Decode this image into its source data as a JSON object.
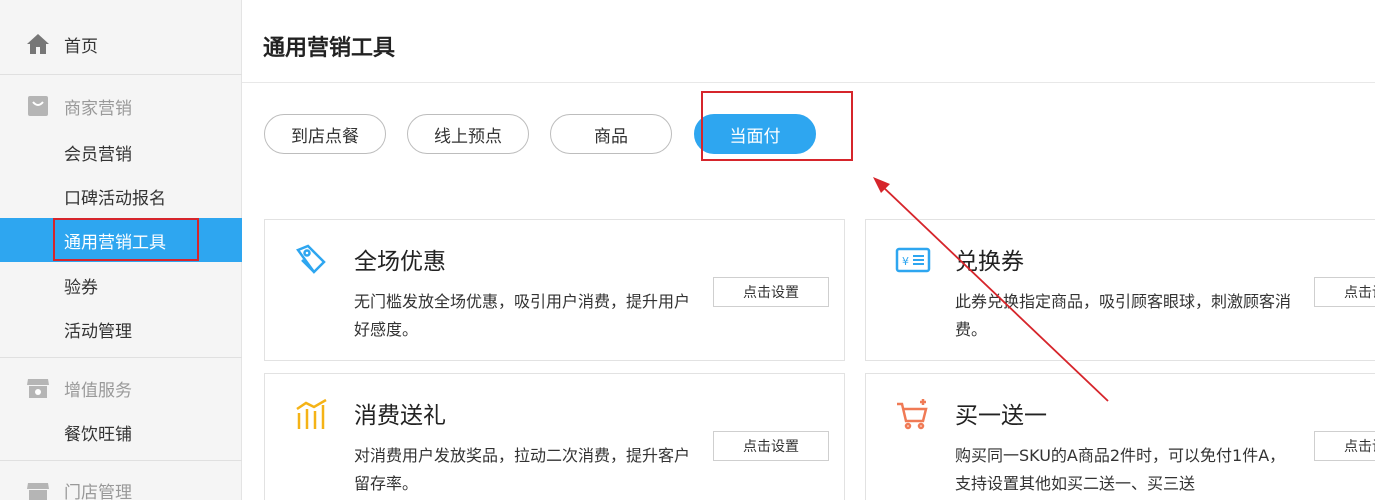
{
  "sidebar": {
    "home": "首页",
    "merchant_marketing": "商家营销",
    "member_marketing": "会员营销",
    "koubei_signup": "口碑活动报名",
    "general_tools": "通用营销工具",
    "coupon_verify": "验券",
    "activity_manage": "活动管理",
    "value_added": "增值服务",
    "catering": "餐饮旺铺",
    "store_manage": "门店管理"
  },
  "header": {
    "title": "通用营销工具"
  },
  "tabs": [
    "到店点餐",
    "线上预点",
    "商品",
    "当面付"
  ],
  "active_tab": "当面付",
  "cards": [
    {
      "title": "全场优惠",
      "desc": "无门槛发放全场优惠，吸引用户消费，提升用户好感度。",
      "button": "点击设置",
      "icon": "discount-tag-icon",
      "color": "#2ea6f0"
    },
    {
      "title": "兑换券",
      "desc": "此券兑换指定商品，吸引顾客眼球，刺激顾客消费。",
      "button": "点击设置",
      "icon": "yen-voucher-icon",
      "color": "#2ea6f0"
    },
    {
      "title": "消费送礼",
      "desc": "对消费用户发放奖品，拉动二次消费，提升客户留存率。",
      "button": "点击设置",
      "icon": "gift-bars-icon",
      "color": "#f5b316"
    },
    {
      "title": "买一送一",
      "desc": "购买同一SKU的A商品2件时，可以免付1件A，支持设置其他如买二送一、买三送",
      "button": "点击设置",
      "icon": "cart-plus-icon",
      "color": "#f07a55"
    }
  ],
  "colors": {
    "accent": "#2ea6f0",
    "highlight": "#d6252b"
  }
}
